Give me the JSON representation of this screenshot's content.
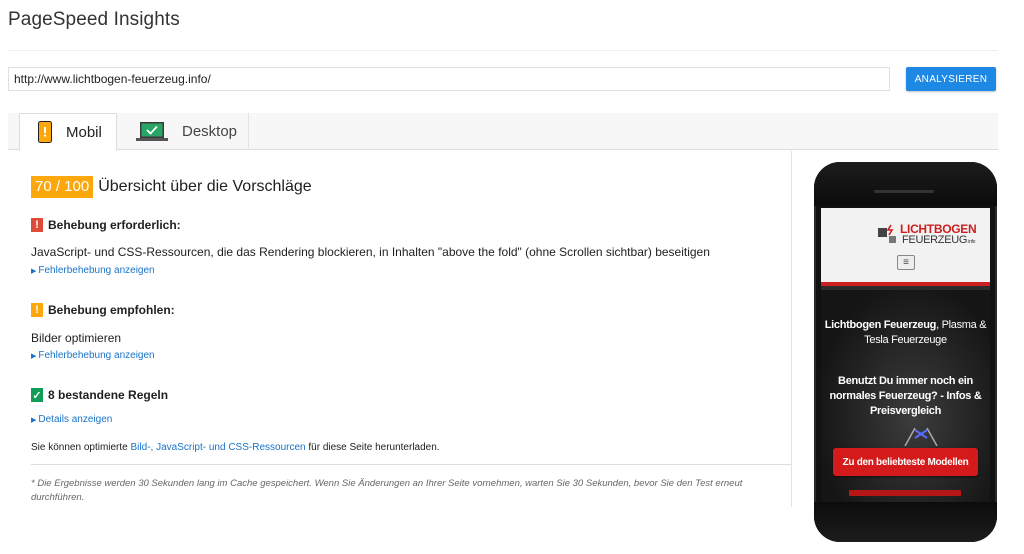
{
  "app": {
    "title": "PageSpeed Insights"
  },
  "search": {
    "value": "http://www.lichtbogen-feuerzeug.info/",
    "button_label": "ANALYSIEREN"
  },
  "tabs": [
    {
      "label": "Mobil",
      "active": true,
      "icon": "mobile-phone-icon"
    },
    {
      "label": "Desktop",
      "active": false,
      "icon": "desktop-monitor-icon"
    }
  ],
  "summary": {
    "score": "70 / 100",
    "heading": "Übersicht über die Vorschläge"
  },
  "sections": {
    "required": {
      "icon": "exclamation-icon",
      "title": "Behebung erforderlich:",
      "rule": "JavaScript- und CSS-Ressourcen, die das Rendering blockieren, in Inhalten \"above the fold\" (ohne Scrollen sichtbar) beseitigen",
      "link": "Fehlerbehebung anzeigen"
    },
    "recommended": {
      "icon": "exclamation-icon",
      "title": "Behebung empfohlen:",
      "rule": "Bilder optimieren",
      "link": "Fehlerbehebung anzeigen"
    },
    "passed": {
      "icon": "checkmark-icon",
      "title": "8 bestandene Regeln",
      "link": "Details anzeigen"
    }
  },
  "download": {
    "prefix": "Sie können optimierte ",
    "link": "Bild-, JavaScript- und CSS-Ressourcen",
    "suffix": " für diese Seite herunterladen."
  },
  "footnote": "* Die Ergebnisse werden 30 Sekunden lang im Cache gespeichert. Wenn Sie Änderungen an Ihrer Seite vornehmen, warten Sie 30 Sekunden, bevor Sie den Test erneut durchführen.",
  "preview": {
    "logo_line1": "LICHTBOGEN",
    "logo_line2": "FEUERZEUG",
    "logo_suffix": ".info",
    "headline_bold": "Lichtbogen Feuerzeug",
    "headline_rest": ", Plasma & Tesla Feuerzeuge",
    "subheadline": "Benutzt Du immer noch ein normales Feuerzeug? - Infos & Preisvergleich",
    "cta": "Zu den beliebteste Modellen"
  },
  "colors": {
    "accent": "#1e88e5",
    "score": "#fca70c",
    "error": "#dd4b39",
    "warning": "#fca70c",
    "success": "#109d58",
    "link": "#1a73c9"
  }
}
